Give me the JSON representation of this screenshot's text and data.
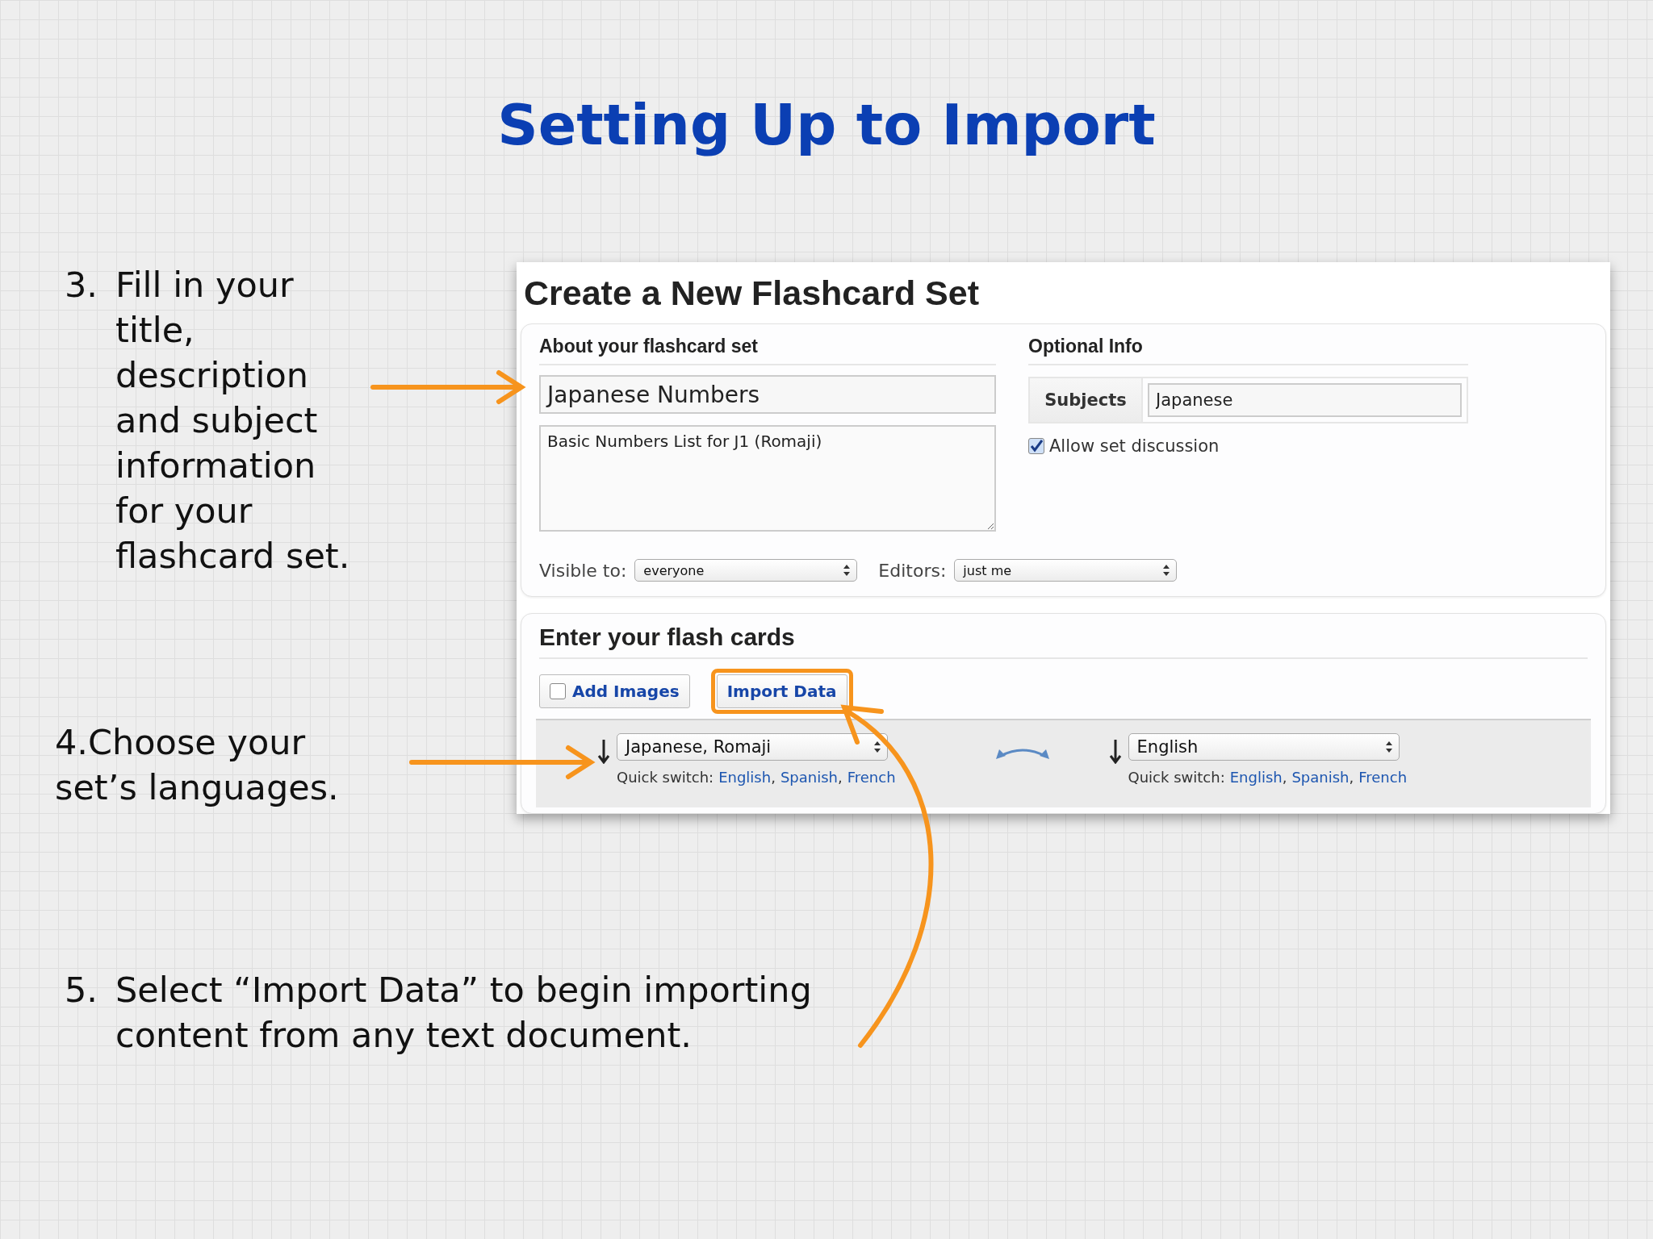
{
  "title": "Setting Up to Import",
  "steps": [
    {
      "number": "3.",
      "text": "Fill in your title, description and subject information for your flashcard set.",
      "kind": "hanging"
    },
    {
      "number": "4.",
      "text": "Choose your set’s languages.",
      "kind": "runin"
    },
    {
      "number": "5.",
      "text": "Select “Import Data” to begin importing content from any text document.",
      "kind": "hanging"
    }
  ],
  "screenshot": {
    "heading": "Create a New Flashcard Set",
    "about": {
      "heading": "About your flashcard set",
      "title_value": "Japanese Numbers",
      "description_value": "Basic Numbers List for J1 (Romaji)"
    },
    "visibility": {
      "label": "Visible to:",
      "value": "everyone"
    },
    "editors": {
      "label": "Editors:",
      "value": "just me"
    },
    "optional": {
      "heading": "Optional Info",
      "subjects_label": "Subjects",
      "subjects_value": "Japanese",
      "discussion": {
        "label": "Allow set discussion",
        "checked": true
      }
    },
    "cards": {
      "heading": "Enter your flash cards",
      "add_images": {
        "label": "Add Images",
        "checked": false
      },
      "import_button": {
        "label": "Import Data",
        "highlighted": true
      },
      "languages": [
        {
          "value": "Japanese, Romaji",
          "quick_label": "Quick switch:",
          "separator": ",",
          "quick_links": [
            "English",
            "Spanish",
            "French"
          ]
        },
        {
          "value": "English",
          "quick_label": "Quick switch:",
          "separator": ",",
          "quick_links": [
            "English",
            "Spanish",
            "French"
          ]
        }
      ]
    }
  }
}
